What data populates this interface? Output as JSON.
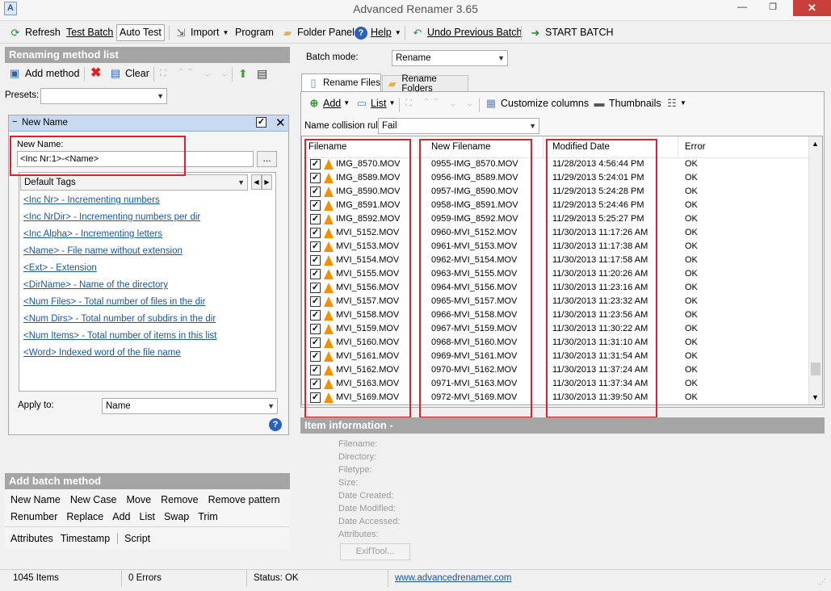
{
  "window": {
    "title": "Advanced Renamer 3.65",
    "min_glyph": "—",
    "max_glyph": "❐",
    "close_glyph": "✕"
  },
  "toolbar": {
    "refresh": "Refresh",
    "test_batch": "Test Batch",
    "auto_test": "Auto Test",
    "import": "Import",
    "program": "Program",
    "folder_panel": "Folder Panel",
    "help": "Help",
    "undo": "Undo Previous Batch",
    "start": "START BATCH"
  },
  "left": {
    "method_list_header": "Renaming method list",
    "add_method": "Add method",
    "clear": "Clear",
    "presets_label": "Presets:",
    "presets_value": "",
    "method_title": "New Name",
    "new_name_label": "New Name:",
    "new_name_value": "<Inc Nr:1>-<Name>",
    "browse": "...",
    "tags_select": "Default Tags",
    "tags": [
      "<Inc Nr> - Incrementing numbers",
      "<Inc NrDir> - Incrementing numbers per dir",
      "<Inc Alpha> - Incrementing letters",
      "<Name> - File name without extension",
      "<Ext> - Extension",
      "<DirName> - Name of the directory",
      "<Num Files> - Total number of files in the dir",
      "<Num Dirs> - Total number of subdirs in the dir",
      "<Num Items> - Total number of items in this list",
      "<Word> Indexed word of the file name"
    ],
    "apply_to_label": "Apply to:",
    "apply_to_value": "Name",
    "batch_header": "Add batch method",
    "batch_row1": [
      "New Name",
      "New Case",
      "Move",
      "Remove",
      "Remove pattern"
    ],
    "batch_row2": [
      "Renumber",
      "Replace",
      "Add",
      "List",
      "Swap",
      "Trim"
    ],
    "batch_row3": [
      "Attributes",
      "Timestamp",
      "Script"
    ]
  },
  "right": {
    "batch_mode_label": "Batch mode:",
    "batch_mode_value": "Rename",
    "tab_files": "Rename Files",
    "tab_folders": "Rename Folders",
    "add": "Add",
    "list": "List",
    "customize": "Customize columns",
    "thumbnails": "Thumbnails",
    "collision_label": "Name collision rule:",
    "collision_value": "Fail",
    "columns": [
      "Filename",
      "New Filename",
      "Modified Date",
      "Error"
    ],
    "rows": [
      [
        "IMG_8570.MOV",
        "0955-IMG_8570.MOV",
        "11/28/2013 4:56:44 PM",
        "OK"
      ],
      [
        "IMG_8589.MOV",
        "0956-IMG_8589.MOV",
        "11/29/2013 5:24:01 PM",
        "OK"
      ],
      [
        "IMG_8590.MOV",
        "0957-IMG_8590.MOV",
        "11/29/2013 5:24:28 PM",
        "OK"
      ],
      [
        "IMG_8591.MOV",
        "0958-IMG_8591.MOV",
        "11/29/2013 5:24:46 PM",
        "OK"
      ],
      [
        "IMG_8592.MOV",
        "0959-IMG_8592.MOV",
        "11/29/2013 5:25:27 PM",
        "OK"
      ],
      [
        "MVI_5152.MOV",
        "0960-MVI_5152.MOV",
        "11/30/2013 11:17:26 AM",
        "OK"
      ],
      [
        "MVI_5153.MOV",
        "0961-MVI_5153.MOV",
        "11/30/2013 11:17:38 AM",
        "OK"
      ],
      [
        "MVI_5154.MOV",
        "0962-MVI_5154.MOV",
        "11/30/2013 11:17:58 AM",
        "OK"
      ],
      [
        "MVI_5155.MOV",
        "0963-MVI_5155.MOV",
        "11/30/2013 11:20:26 AM",
        "OK"
      ],
      [
        "MVI_5156.MOV",
        "0964-MVI_5156.MOV",
        "11/30/2013 11:23:16 AM",
        "OK"
      ],
      [
        "MVI_5157.MOV",
        "0965-MVI_5157.MOV",
        "11/30/2013 11:23:32 AM",
        "OK"
      ],
      [
        "MVI_5158.MOV",
        "0966-MVI_5158.MOV",
        "11/30/2013 11:23:56 AM",
        "OK"
      ],
      [
        "MVI_5159.MOV",
        "0967-MVI_5159.MOV",
        "11/30/2013 11:30:22 AM",
        "OK"
      ],
      [
        "MVI_5160.MOV",
        "0968-MVI_5160.MOV",
        "11/30/2013 11:31:10 AM",
        "OK"
      ],
      [
        "MVI_5161.MOV",
        "0969-MVI_5161.MOV",
        "11/30/2013 11:31:54 AM",
        "OK"
      ],
      [
        "MVI_5162.MOV",
        "0970-MVI_5162.MOV",
        "11/30/2013 11:37:24 AM",
        "OK"
      ],
      [
        "MVI_5163.MOV",
        "0971-MVI_5163.MOV",
        "11/30/2013 11:37:34 AM",
        "OK"
      ],
      [
        "MVI_5169.MOV",
        "0972-MVI_5169.MOV",
        "11/30/2013 11:39:50 AM",
        "OK"
      ]
    ],
    "item_info_header": "Item information -",
    "info_fields": [
      "Filename:",
      "Directory:",
      "Filetype:",
      "Size:",
      "Date Created:",
      "Date Modified:",
      "Date Accessed:",
      "Attributes:"
    ],
    "exiftool": "ExifTool..."
  },
  "status": {
    "items": "1045 Items",
    "errors": "0 Errors",
    "status": "Status: OK",
    "url": "www.advancedrenamer.com"
  },
  "colors": {
    "header_gray": "#a5a5a5",
    "link_blue": "#1a56a6",
    "highlight_red": "#e0202a",
    "close_red": "#c7403a",
    "vlc_orange": "#f29100"
  }
}
